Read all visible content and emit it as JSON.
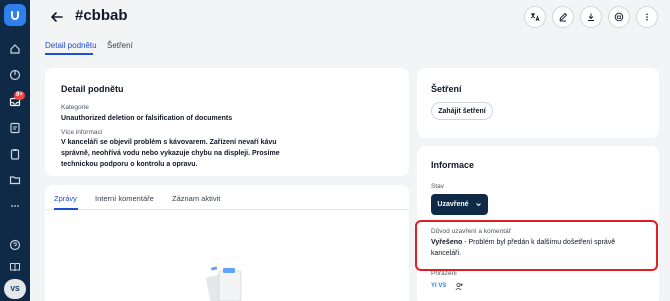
{
  "rail": {
    "badge": "9+",
    "avatar": "VS",
    "icons": [
      "home-icon",
      "dashboard-icon",
      "inbox-icon",
      "reports-icon",
      "clipboard-icon",
      "folder-icon",
      "more-icon",
      "help-icon",
      "book-icon"
    ]
  },
  "header": {
    "title": "#cbbab",
    "tabs": [
      {
        "label": "Detail podnětu",
        "active": true
      },
      {
        "label": "Šetření",
        "active": false
      }
    ],
    "actions": [
      "translate-icon",
      "edit-icon",
      "download-icon",
      "print-icon",
      "more-vertical-icon"
    ]
  },
  "detail": {
    "title": "Detail podnětu",
    "category_label": "Kategorie",
    "category_value": "Unauthorized deletion or falsification of documents",
    "more_info_label": "Více informací",
    "more_info_value": "V kanceláři se objevil problém s kávovarem. Zařízení nevaří kávu správně, neohřívá vodu nebo vykazuje chybu na displeji. Prosíme technickou podporu o kontrolu a opravu."
  },
  "messages": {
    "tabs": [
      {
        "label": "Zprávy",
        "active": true
      },
      {
        "label": "Interní komentáře",
        "active": false
      },
      {
        "label": "Záznam aktivit",
        "active": false
      }
    ]
  },
  "investigation": {
    "title": "Šetření",
    "start_button": "Zahájit šetření"
  },
  "info": {
    "title": "Informace",
    "state_label": "Stav",
    "state_value": "Uzavřené",
    "closing_label": "Důvod uzavření a komentář",
    "closing_reason": "Vyřešeno",
    "closing_comment": " - Problém byl předán k dalšímu došetření správě kanceláři.",
    "assigned_label": "Přiřazeni",
    "assignee": "YI VS"
  },
  "colors": {
    "accent": "#1d4ed8",
    "rail": "#0f2a47",
    "highlight": "#e11d28"
  }
}
